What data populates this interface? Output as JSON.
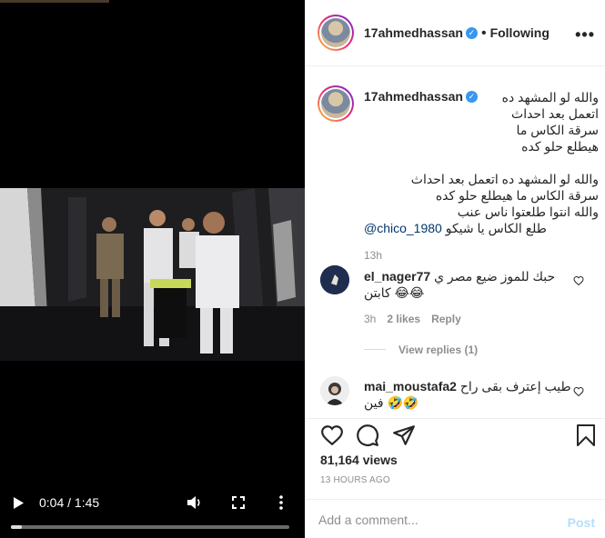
{
  "header": {
    "username": "17ahmedhassan",
    "separator": "•",
    "follow_state": "Following",
    "more_glyph": "•••"
  },
  "video": {
    "time_display": "0:04 / 1:45",
    "progress_fraction": 0.04
  },
  "caption": {
    "username": "17ahmedhassan",
    "line1": "والله لو المشهد ده اتعمل بعد احداث سرقة الكاس ما هيطلع حلو كده",
    "line2": "والله لو المشهد ده اتعمل بعد احداث سرقة الكاس ما هيطلع حلو كده",
    "line3": "والله انتوا طلعتوا ناس عنب",
    "line4_text": "طلع الكاس يا شيكو",
    "line4_mention": "@chico_1980",
    "age": "13h"
  },
  "comments": [
    {
      "username": "el_nager77",
      "text": "حبك للموز ضيع مصر ي كابتن 😂😂",
      "age": "3h",
      "likes": "2 likes",
      "reply_label": "Reply",
      "view_replies": "View replies (1)"
    },
    {
      "username": "mai_moustafa2",
      "text": "طيب إعترف بقى راح فين 🤣🤣"
    }
  ],
  "actions": {
    "views": "81,164 views",
    "posted": "13 HOURS AGO"
  },
  "add_comment": {
    "placeholder": "Add a comment...",
    "post_label": "Post"
  },
  "icons": {
    "verified": "verified-badge-icon",
    "play": "play-icon",
    "volume": "volume-icon",
    "fullscreen": "fullscreen-icon",
    "kebab": "kebab-icon",
    "heart": "heart-icon",
    "comment": "comment-icon",
    "share": "share-icon",
    "save": "bookmark-icon"
  },
  "colors": {
    "link": "#00376b",
    "verified": "#3897f0",
    "post_disabled": "#b2dffc",
    "muted": "#8e8e8e"
  }
}
